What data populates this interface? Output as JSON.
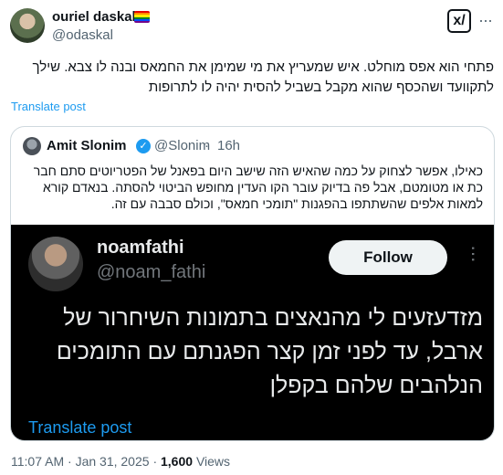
{
  "author": {
    "display_name": "ouriel daskal",
    "handle": "@odaskal",
    "badge_icon": "rainbow-flag-icon"
  },
  "actions": {
    "grok_icon": "grok-icon",
    "more_icon": "more-horizontal-icon",
    "grok_label": "x/"
  },
  "tweet": {
    "text": "פתחי הוא אפס מוחלט. איש שמעריץ את מי שמימן את החמאס ובנה לו צבא. שילך לתקוועד ושהכסף שהוא מקבל בשביל להסית יהיה לו לתרופות",
    "translate_label": "Translate post"
  },
  "quote": {
    "author_name": "Amit Slonim",
    "verified": true,
    "handle": "@Slonim",
    "separator": "·",
    "time": "16h",
    "text": "כאילו, אפשר לצחוק על כמה שהאיש הזה שישב היום בפאנל של הפטריוטים סתם חבר כת או מטומטם, אבל פה בדיוק עובר הקו העדין מחופש הביטוי להסתה. בנאדם קורא למאות אלפים שהשתתפו בהפגנות \"תומכי חמאס\", וכולם סבבה עם זה.",
    "media": {
      "display_name": "noamfathi",
      "handle": "@noam_fathi",
      "follow_label": "Follow",
      "more_label": "···",
      "text": "מזדעזעים לי מהנאצים בתמונות השיחרור של ארבל, עד לפני זמן קצר הפגנתם עם התומכים הנלהבים שלהם בקפלן",
      "translate_label": "Translate post"
    }
  },
  "footer": {
    "time": "11:07 AM",
    "separator": "·",
    "date": "Jan 31, 2025",
    "views_count": "1,600",
    "views_label": "Views"
  },
  "colors": {
    "link": "#1d9bf0",
    "muted": "#536471",
    "text": "#0f1419",
    "border": "#cfd9de",
    "media_bg": "#000000"
  }
}
